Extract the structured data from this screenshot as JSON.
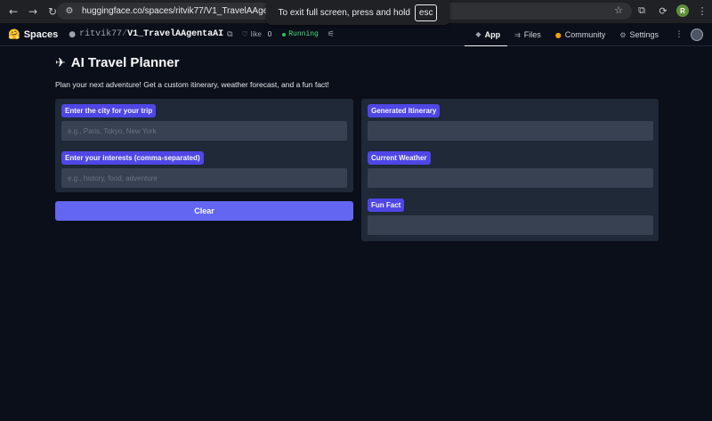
{
  "browser": {
    "url": "huggingface.co/spaces/ritvik77/V1_TravelAAgentaAI",
    "profile_initial": "R",
    "fullscreen_toast": {
      "text": "To exit full screen, press and hold",
      "key": "esc"
    }
  },
  "hf_header": {
    "brand": "Spaces",
    "owner": "ritvik77",
    "repo": "V1_TravelAAgentaAI",
    "like_label": "like",
    "like_count": "0",
    "status": "Running",
    "tabs": [
      {
        "label": "App",
        "icon": "app-icon"
      },
      {
        "label": "Files",
        "icon": "files-icon"
      },
      {
        "label": "Community",
        "icon": "community-icon"
      },
      {
        "label": "Settings",
        "icon": "gear-icon"
      }
    ]
  },
  "app": {
    "title": "AI Travel Planner",
    "title_icon": "airplane-icon",
    "subtitle": "Plan your next adventure! Get a custom itinerary, weather forecast, and a fun fact!",
    "inputs": [
      {
        "label": "Enter the city for your trip",
        "placeholder": "e.g., Paris, Tokyo, New York"
      },
      {
        "label": "Enter your interests (comma-separated)",
        "placeholder": "e.g., history, food, adventure"
      }
    ],
    "clear_label": "Clear",
    "outputs": [
      {
        "label": "Generated Itinerary"
      },
      {
        "label": "Current Weather"
      },
      {
        "label": "Fun Fact"
      }
    ]
  },
  "colors": {
    "background": "#0b0f19",
    "panel": "#1f2937",
    "field": "#374151",
    "label": "#4f46e5",
    "button": "#6366f1"
  }
}
